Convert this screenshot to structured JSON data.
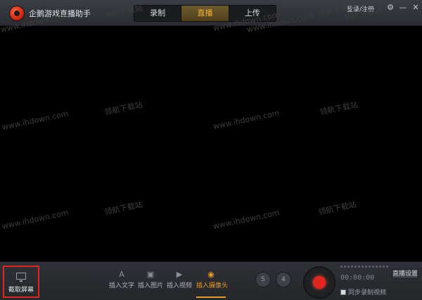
{
  "app": {
    "title": "企鹅游戏直播助手"
  },
  "tabs": [
    {
      "label": "录制",
      "active": false
    },
    {
      "label": "直播",
      "active": true
    },
    {
      "label": "上传",
      "active": false
    }
  ],
  "header": {
    "login_label": "登录/注册",
    "minimize_glyph": "—",
    "close_glyph": "✕"
  },
  "watermarks": [
    "领航下载站",
    "www.ihdown.com",
    "领航下载站",
    "www.ihdown.com",
    "领航下载站",
    "www.ihdown.com",
    "领航下载站",
    "www.ihdown.com",
    "领航下载站",
    "www.ihdown.com",
    "领航下载站",
    "www.ihdown.com",
    "领航下载站",
    "www.ihdown.com"
  ],
  "bottom": {
    "capture_label": "截取屏幕",
    "tools": [
      {
        "label": "插入文字",
        "icon": "text-icon",
        "glyph": "A",
        "active": false
      },
      {
        "label": "插入图片",
        "icon": "image-icon",
        "glyph": "▣",
        "active": false
      },
      {
        "label": "插入视频",
        "icon": "video-icon",
        "glyph": "▶",
        "active": false
      },
      {
        "label": "插入摄像头",
        "icon": "camera-icon",
        "glyph": "◉",
        "active": true
      }
    ],
    "round_buttons": [
      "S",
      "4"
    ],
    "timer": "00:00:00",
    "sync_label": "同步录制视频",
    "settings_label": "直播设置"
  },
  "colors": {
    "accent": "#e89a2a",
    "record": "#e0261f",
    "highlight_box": "#e0261f"
  }
}
